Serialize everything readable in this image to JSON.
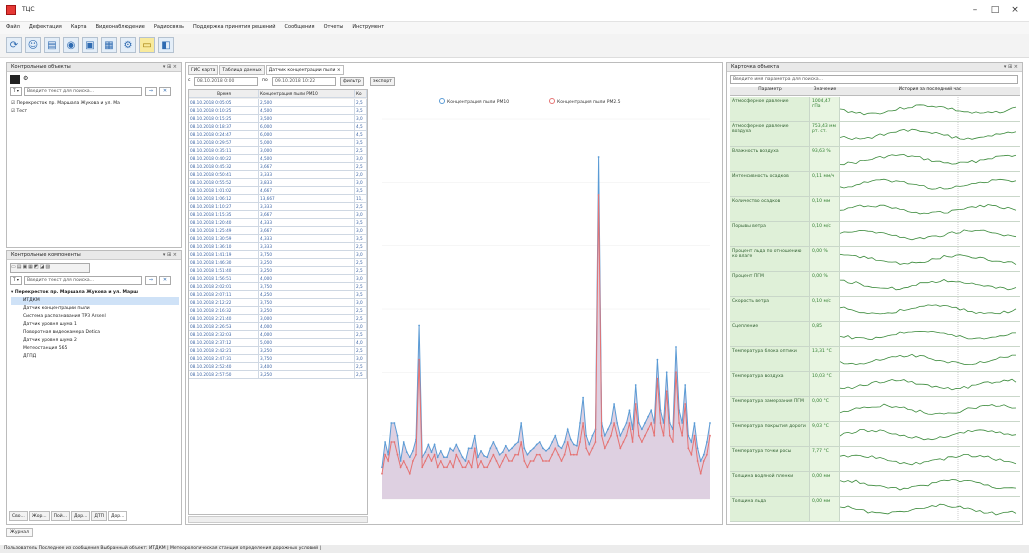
{
  "window": {
    "title": "ТЦС",
    "minimize": "–",
    "maximize": "□",
    "close": "×"
  },
  "menu": [
    "Файл",
    "Дефектация",
    "Карта",
    "Видеонаблюдение",
    "Радиосвязь",
    "Поддержка принятия решений",
    "Сообщения",
    "Отчеты",
    "Инструмент"
  ],
  "left": {
    "objects_title": "Контрольные объекты",
    "search_placeholder": "Введите текст для поиска...",
    "objects": [
      "Перекресток пр. Маршала Жукова и ул. Ма",
      "Тест"
    ],
    "components_title": "Контрольные компоненты",
    "components_root": "Перекресток пр. Маршала Жукова и ул. Марш",
    "components": [
      "ИТДКМ",
      "Датчик концентрации пыли",
      "Система распознавания ТРЗ Arsenl",
      "Датчик уровня шума 1",
      "Поворотная видеокамера Detica",
      "Датчик уровня шума 2",
      "Метеостанция 565",
      "ДГПД"
    ],
    "bottom_tabs": [
      "Сво...",
      "Жор...",
      "Пой...",
      "Дор...",
      "ДТП",
      "Дор..."
    ]
  },
  "center": {
    "tabs": [
      "ГИС карта",
      "Таблица данных",
      "Датчик концентрации пыли"
    ],
    "from_label": "с",
    "from_value": "08.10.2018 0:00",
    "to_label": "по",
    "to_value": "09.10.2018 10:22",
    "filter_btn": "фильтр",
    "export_btn": "экспорт",
    "col_time": "Время",
    "col_pm10": "Концентрация пыли PM10",
    "col_extra": "Ко"
  },
  "table_rows": [
    [
      "08.10.2018 0:05:05",
      "2,500",
      "2,5"
    ],
    [
      "08.10.2018 0:10:25",
      "4,500",
      "3,5"
    ],
    [
      "08.10.2018 0:15:25",
      "3,500",
      "3,0"
    ],
    [
      "08.10.2018 0:18:37",
      "6,000",
      "4,5"
    ],
    [
      "08.10.2018 0:24:47",
      "6,000",
      "4,5"
    ],
    [
      "08.10.2018 0:29:57",
      "5,000",
      "3,5"
    ],
    [
      "08.10.2018 0:35:11",
      "3,000",
      "2,5"
    ],
    [
      "08.10.2018 0:40:22",
      "4,500",
      "3,0"
    ],
    [
      "08.10.2018 0:45:32",
      "3,667",
      "2,5"
    ],
    [
      "08.10.2018 0:50:41",
      "3,333",
      "2,0"
    ],
    [
      "08.10.2018 0:55:52",
      "3,833",
      "3,0"
    ],
    [
      "08.10.2018 1:01:02",
      "4,667",
      "3,5"
    ],
    [
      "08.10.2018 1:06:12",
      "13,667",
      "11,"
    ],
    [
      "08.10.2018 1:10:27",
      "3,333",
      "2,5"
    ],
    [
      "08.10.2018 1:15:35",
      "3,667",
      "3,0"
    ],
    [
      "08.10.2018 1:20:40",
      "4,333",
      "3,5"
    ],
    [
      "08.10.2018 1:25:49",
      "3,667",
      "3,0"
    ],
    [
      "08.10.2018 1:30:59",
      "4,333",
      "3,5"
    ],
    [
      "08.10.2018 1:36:10",
      "3,333",
      "2,5"
    ],
    [
      "08.10.2018 1:41:19",
      "3,750",
      "3,0"
    ],
    [
      "08.10.2018 1:46:30",
      "3,250",
      "2,5"
    ],
    [
      "08.10.2018 1:51:40",
      "3,250",
      "2,5"
    ],
    [
      "08.10.2018 1:56:51",
      "4,000",
      "3,0"
    ],
    [
      "08.10.2018 2:02:01",
      "3,750",
      "2,5"
    ],
    [
      "08.10.2018 2:07:11",
      "4,250",
      "3,5"
    ],
    [
      "08.10.2018 2:12:22",
      "3,750",
      "3,0"
    ],
    [
      "08.10.2018 2:16:32",
      "3,250",
      "2,5"
    ],
    [
      "08.10.2018 2:21:40",
      "3,000",
      "2,5"
    ],
    [
      "08.10.2018 2:26:53",
      "4,000",
      "3,0"
    ],
    [
      "08.10.2018 2:32:03",
      "4,000",
      "2,5"
    ],
    [
      "08.10.2018 2:37:12",
      "5,000",
      "4,0"
    ],
    [
      "08.10.2018 2:42:21",
      "3,250",
      "2,5"
    ],
    [
      "08.10.2018 2:47:31",
      "3,750",
      "3,0"
    ],
    [
      "08.10.2018 2:52:40",
      "3,400",
      "2,5"
    ],
    [
      "08.10.2018 2:57:50",
      "3,250",
      "2,5"
    ]
  ],
  "chart_data": {
    "type": "area",
    "series": [
      {
        "name": "Концентрация пыли PM10",
        "color": "#5b9bd5",
        "values": [
          2.5,
          4.5,
          3.5,
          6,
          6,
          5,
          3,
          4.5,
          3.7,
          3.3,
          3.8,
          4.7,
          13.7,
          3.3,
          3.7,
          4.3,
          3.7,
          4.3,
          3.3,
          3.8,
          3.3,
          3.3,
          4,
          3.8,
          4.3,
          3.8,
          3.3,
          3,
          4,
          4,
          5,
          3.3,
          3.8,
          3.4,
          3.3,
          4,
          4.5,
          4,
          3.5,
          3.7,
          4.2,
          3.8,
          4,
          4.3,
          4.5,
          6,
          4,
          3.5,
          3.8,
          4,
          4.3,
          4.5,
          4,
          3.8,
          4,
          4.5,
          5,
          4.2,
          4,
          4.5,
          5.5,
          4.7,
          4.3,
          4.2,
          6,
          8,
          5,
          4.3,
          5,
          5.5,
          27,
          6,
          5,
          5.5,
          6,
          7.5,
          6,
          5,
          5.5,
          6,
          7,
          5.5,
          9,
          6,
          5.5,
          6,
          6.5,
          7,
          6,
          11,
          7,
          6,
          10,
          6,
          5.5,
          12,
          7,
          6,
          9,
          5,
          4.5,
          6,
          4,
          3,
          3.5,
          4.5,
          6
        ]
      },
      {
        "name": "Концентрация пыли PM2.5",
        "color": "#e57373",
        "values": [
          2,
          3.5,
          3,
          4.5,
          4.5,
          3.5,
          2.5,
          3,
          2.5,
          2,
          3,
          3.5,
          11,
          2.5,
          3,
          3.5,
          3,
          3.5,
          2.5,
          3,
          2.5,
          2.5,
          3,
          2.5,
          3.5,
          3,
          2.5,
          2.5,
          3,
          2.5,
          4,
          2.5,
          3,
          2.5,
          2.5,
          3,
          3.5,
          3,
          2.5,
          3,
          3.5,
          3,
          3,
          3.5,
          3.5,
          4.5,
          3,
          2.5,
          3,
          3,
          3.5,
          3.5,
          3,
          3,
          3,
          3.5,
          4,
          3.5,
          3,
          3.5,
          4.5,
          3.5,
          3.5,
          3.5,
          4.5,
          6,
          4,
          3.5,
          4,
          4.5,
          24,
          5,
          4,
          4.5,
          5,
          6,
          5,
          4,
          4.5,
          5,
          6,
          4.5,
          7.5,
          5,
          4.5,
          5,
          5.5,
          6,
          5,
          9.5,
          6,
          5,
          8.5,
          5,
          4.5,
          10,
          6,
          5,
          7.5,
          4,
          3.5,
          5,
          3,
          2,
          3,
          3.5,
          5
        ]
      }
    ],
    "fill_color": "#d8c8dc",
    "ylim": [
      0,
      30
    ],
    "grid": true,
    "legend": "top"
  },
  "right": {
    "title": "Карточка объекта",
    "search_placeholder": "Введите имя параметра для поиска...",
    "col_param": "Параметр",
    "col_value": "Значение",
    "col_history": "История за последний час",
    "params": [
      {
        "name": "Атмосферное давление",
        "value": "1004,47 гПа"
      },
      {
        "name": "Атмосферное давление воздуха",
        "value": "753,43 мм рт. ст."
      },
      {
        "name": "Влажность воздуха",
        "value": "93,63 %"
      },
      {
        "name": "Интенсивность осадков",
        "value": "0,11 мм/ч"
      },
      {
        "name": "Количество осадков",
        "value": "0,10 мм"
      },
      {
        "name": "Порывы ветра",
        "value": "0,10 м/с"
      },
      {
        "name": "Процент льда по отношению ко влаге",
        "value": "0,00 %"
      },
      {
        "name": "Процент ПГМ",
        "value": "0,00 %"
      },
      {
        "name": "Скорость ветра",
        "value": "0,10 м/с"
      },
      {
        "name": "Сцепление",
        "value": "0,85"
      },
      {
        "name": "Температура блока оптики",
        "value": "13,31 °С"
      },
      {
        "name": "Температура воздуха",
        "value": "10,03 °С"
      },
      {
        "name": "Температура замерзания ПГМ",
        "value": "0,00 °С"
      },
      {
        "name": "Температура покрытия дороги",
        "value": "9,03 °С"
      },
      {
        "name": "Температура точки росы",
        "value": "7,77 °С"
      },
      {
        "name": "Толщина водяной пленки",
        "value": "0,00 мм"
      },
      {
        "name": "Толщина льда",
        "value": "0,00 мм"
      }
    ]
  },
  "bottom": {
    "journal_tab": "Журнал"
  },
  "status": "Пользователь  Последнее из сообщения   Выбранный объект: ИТДКМ   |  Метеорологическая станция определения дорожных условий  |"
}
